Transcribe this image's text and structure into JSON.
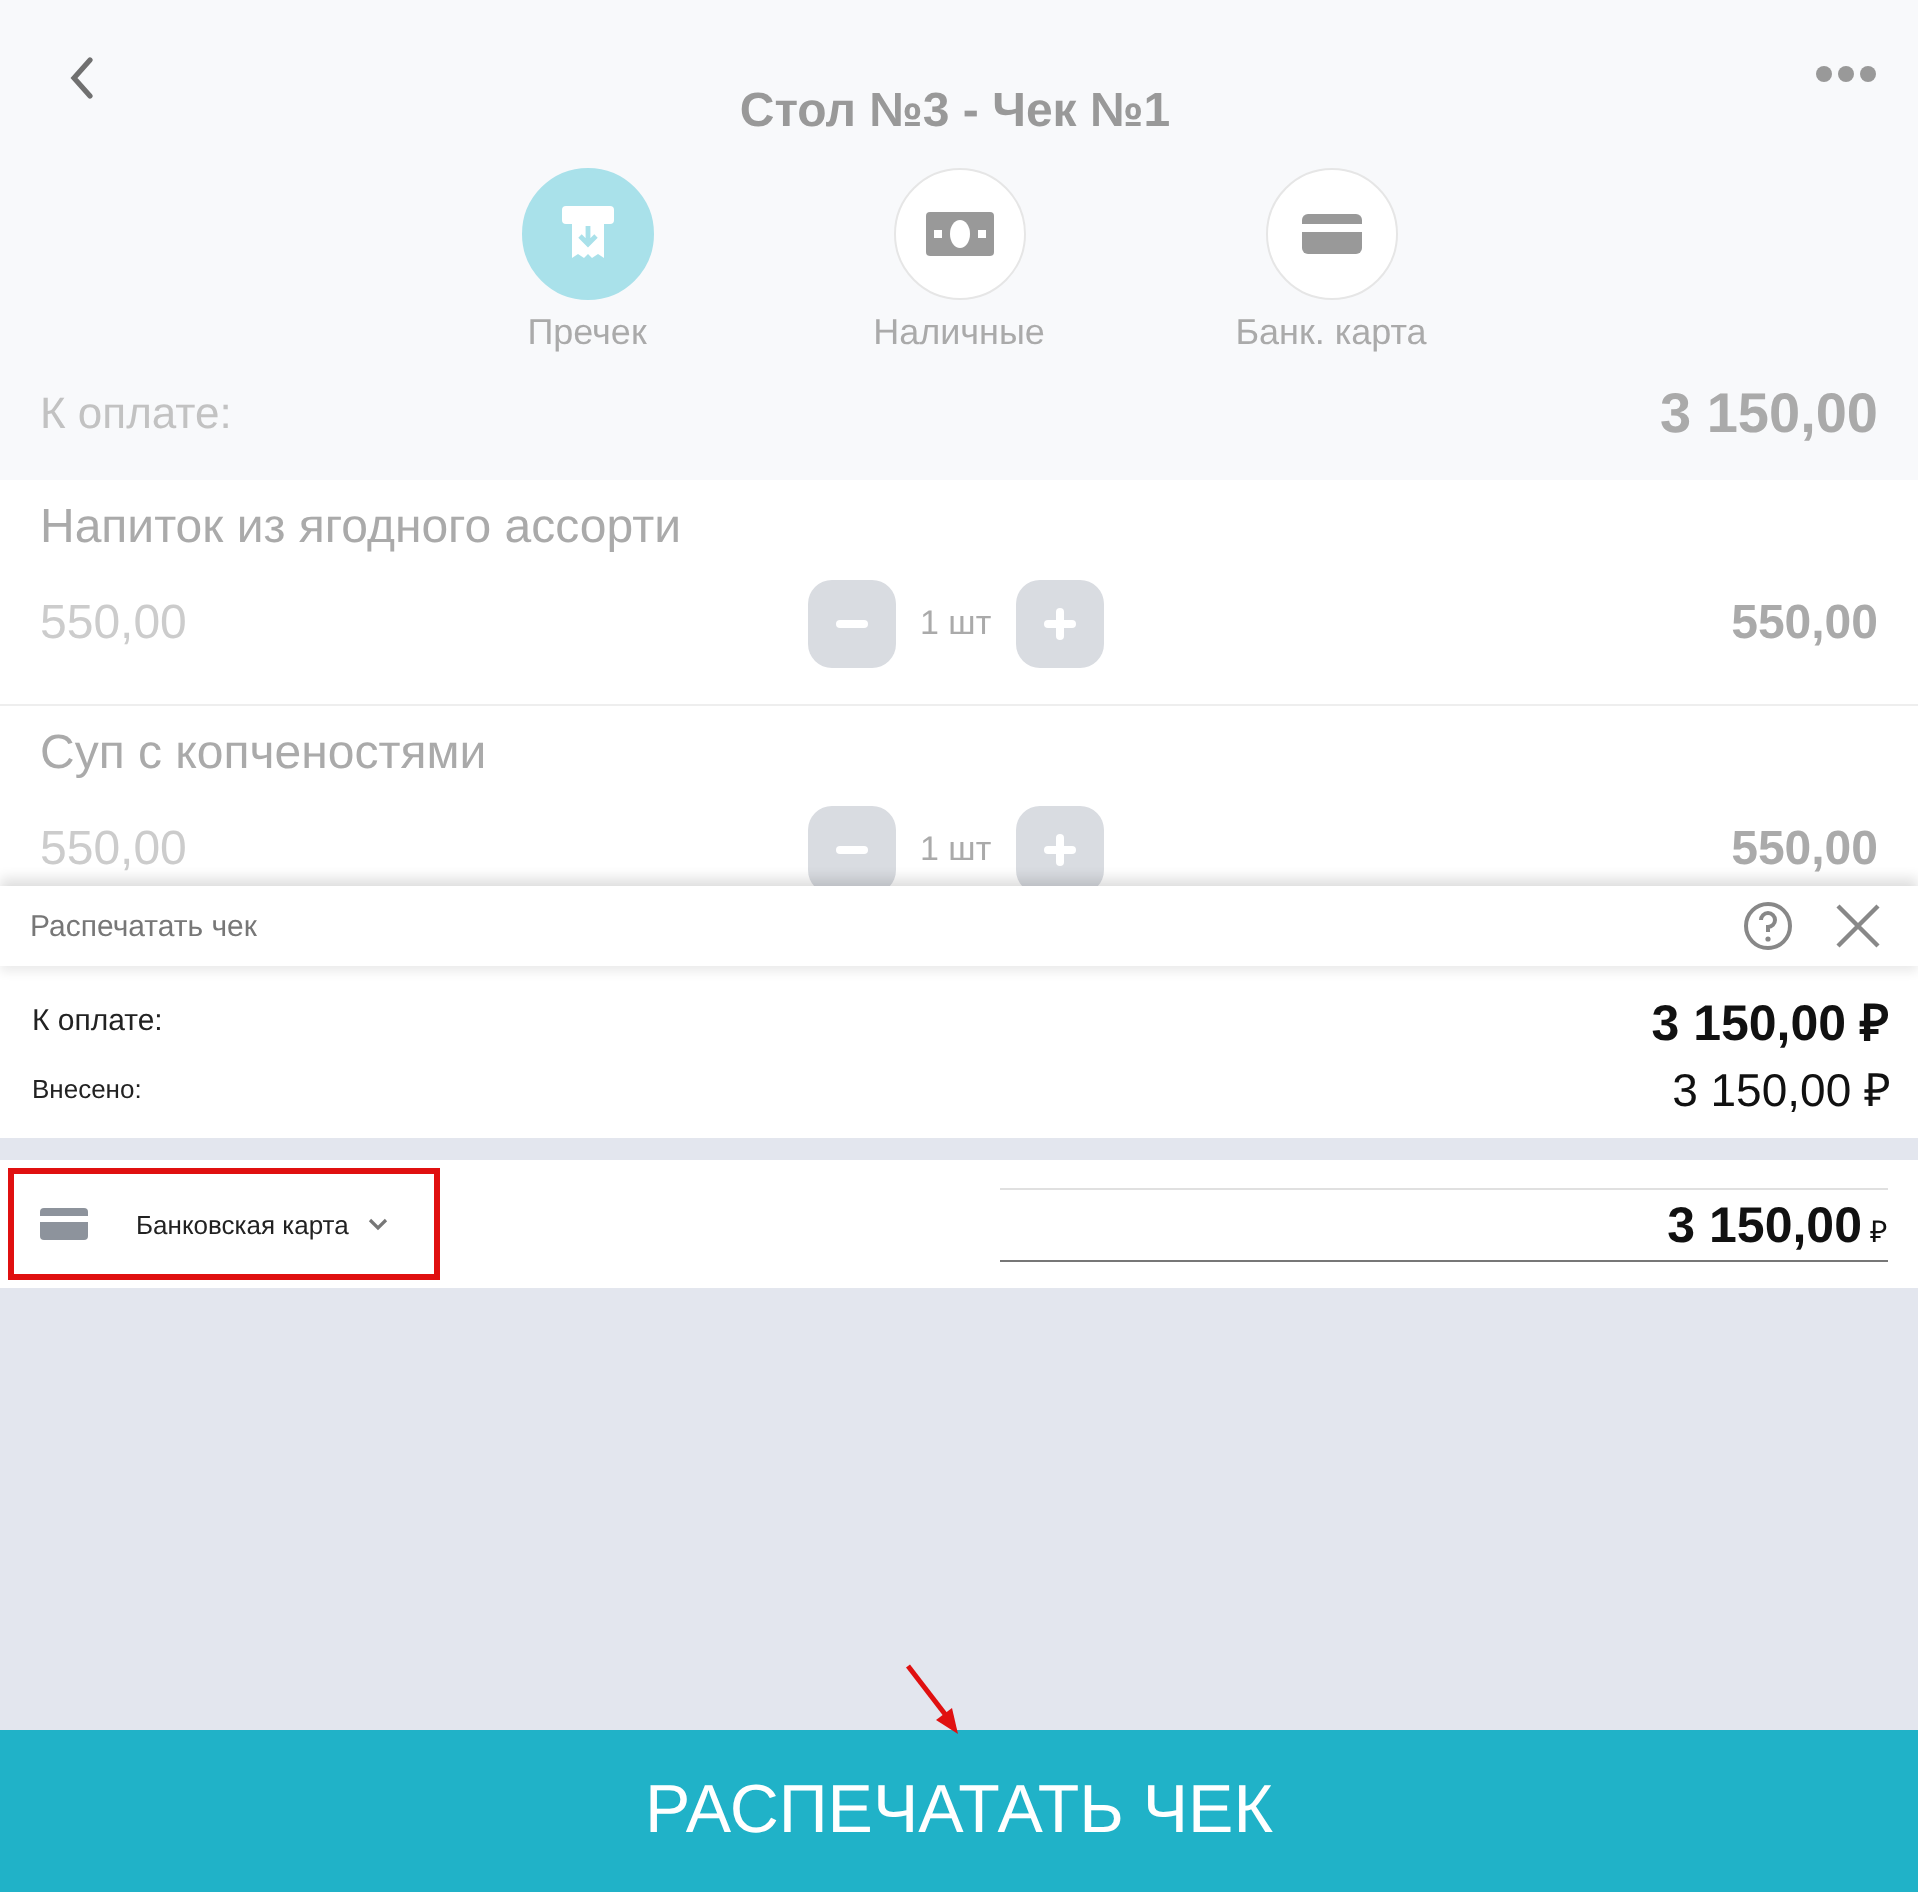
{
  "header": {
    "title": "Стол №3 - Чек №1"
  },
  "modes": [
    {
      "label": "Пречек",
      "kind": "receipt",
      "selected": true
    },
    {
      "label": "Наличные",
      "kind": "cash",
      "selected": false
    },
    {
      "label": "Банк. карта",
      "kind": "card",
      "selected": false
    }
  ],
  "due": {
    "label": "К оплате:",
    "amount": "3 150,00"
  },
  "items": [
    {
      "name": "Напиток из ягодного ассорти",
      "price": "550,00",
      "quantity": "1 шт",
      "total": "550,00"
    },
    {
      "name": "Суп с копченостями",
      "price": "550,00",
      "quantity": "1 шт",
      "total": "550,00"
    }
  ],
  "dialog": {
    "title": "Распечатать чек",
    "due_label": "К оплате:",
    "due_amount": "3 150,00 ₽",
    "paid_label": "Внесено:",
    "paid_amount": "3 150,00 ₽",
    "payment": {
      "method": "Банковская карта",
      "amount": "3 150,00",
      "currency": "₽"
    },
    "button": "РАСПЕЧАТАТЬ ЧЕК"
  }
}
